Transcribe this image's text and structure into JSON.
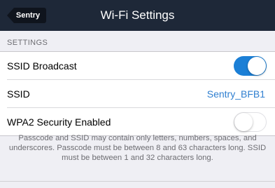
{
  "navbar": {
    "back_label": "Sentry",
    "title": "Wi-Fi Settings"
  },
  "section": {
    "header": "SETTINGS"
  },
  "rows": [
    {
      "label": "SSID Broadcast",
      "type": "toggle",
      "on": true
    },
    {
      "label": "SSID",
      "type": "value",
      "value": "Sentry_BFB1"
    },
    {
      "label": "WPA2 Security Enabled",
      "type": "toggle",
      "on": false
    }
  ],
  "footer_text": "Passcode and SSID may contain only letters, numbers, spaces, and underscores. Passcode must be between 8 and 63 characters long. SSID must be between 1 and 32 characters long.",
  "colors": {
    "navbar": "#1e2838",
    "accent": "#1b7fd6",
    "value_text": "#2f7fd0"
  }
}
